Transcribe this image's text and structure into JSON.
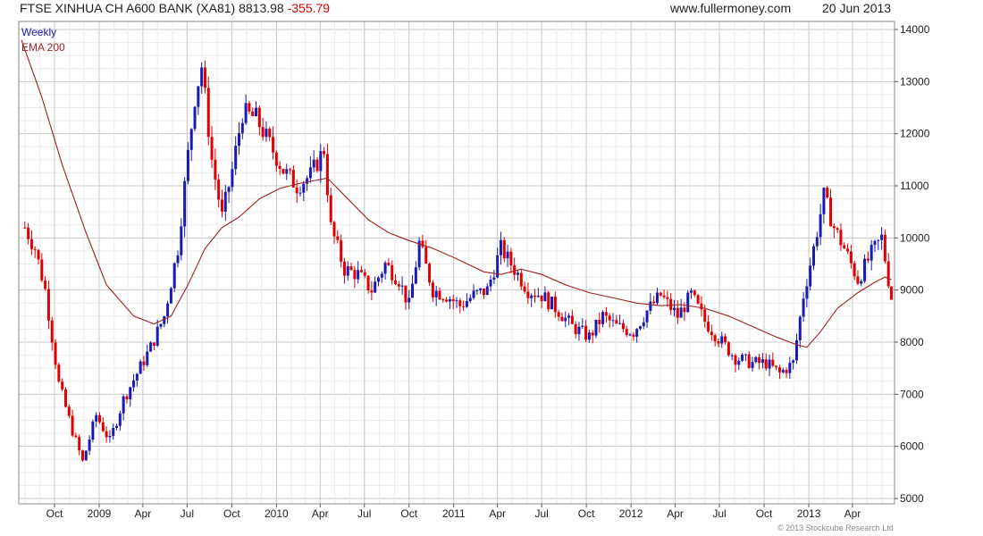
{
  "header": {
    "title": "FTSE XINHUA CH A600 BANK (XA81) 8813.98",
    "change": "-355.79",
    "site": "www.fullermoney.com",
    "date": "20 Jun 2013"
  },
  "copyright": "© 2013 Stockcube Research Ltd",
  "colors": {
    "up": "#1a1ab5",
    "down": "#e00000",
    "ema": "#a02020",
    "grid": "#d9d9d9"
  },
  "chart_data": {
    "type": "candlestick",
    "title": "FTSE XINHUA CH A600 BANK (XA81)",
    "frequency_label": "Weekly",
    "legend": [
      "Weekly",
      "EMA 200"
    ],
    "legend_position": "top-left",
    "grid": true,
    "y_axis_side": "right",
    "ylim": [
      5000,
      14000
    ],
    "yticks": [
      5000,
      6000,
      7000,
      8000,
      9000,
      10000,
      11000,
      12000,
      13000,
      14000
    ],
    "x_labels": [
      "Oct",
      "2009",
      "Apr",
      "Jul",
      "Oct",
      "2010",
      "Apr",
      "Jul",
      "Oct",
      "2011",
      "Apr",
      "Jul",
      "Oct",
      "2012",
      "Apr",
      "Jul",
      "Oct",
      "2013",
      "Apr"
    ],
    "last_close": 8813.98,
    "change": -355.79,
    "series": [
      {
        "name": "Weekly",
        "close_path": [
          [
            "2008-08-01",
            10200
          ],
          [
            "2008-08-22",
            9800
          ],
          [
            "2008-09-12",
            9000
          ],
          [
            "2008-10-10",
            7200
          ],
          [
            "2008-11-07",
            6300
          ],
          [
            "2008-11-28",
            5700
          ],
          [
            "2008-12-26",
            6600
          ],
          [
            "2009-01-23",
            6100
          ],
          [
            "2009-02-20",
            6900
          ],
          [
            "2009-03-20",
            7400
          ],
          [
            "2009-04-17",
            7900
          ],
          [
            "2009-05-15",
            8500
          ],
          [
            "2009-06-12",
            9800
          ],
          [
            "2009-07-03",
            11600
          ],
          [
            "2009-07-17",
            12700
          ],
          [
            "2009-07-31",
            13300
          ],
          [
            "2009-08-21",
            11500
          ],
          [
            "2009-09-11",
            10400
          ],
          [
            "2009-10-02",
            11300
          ],
          [
            "2009-10-23",
            12400
          ],
          [
            "2009-11-20",
            12300
          ],
          [
            "2009-12-18",
            11800
          ],
          [
            "2010-01-15",
            11300
          ],
          [
            "2010-02-12",
            11000
          ],
          [
            "2010-03-12",
            11200
          ],
          [
            "2010-04-09",
            11700
          ],
          [
            "2010-04-23",
            10200
          ],
          [
            "2010-05-21",
            9400
          ],
          [
            "2010-06-18",
            9300
          ],
          [
            "2010-07-16",
            9000
          ],
          [
            "2010-08-13",
            9500
          ],
          [
            "2010-09-10",
            9200
          ],
          [
            "2010-10-01",
            8700
          ],
          [
            "2010-10-22",
            9900
          ],
          [
            "2010-11-19",
            9000
          ],
          [
            "2010-12-17",
            8900
          ],
          [
            "2011-01-14",
            8700
          ],
          [
            "2011-02-11",
            8900
          ],
          [
            "2011-03-11",
            9000
          ],
          [
            "2011-04-08",
            9800
          ],
          [
            "2011-05-06",
            9400
          ],
          [
            "2011-06-03",
            9000
          ],
          [
            "2011-07-01",
            8900
          ],
          [
            "2011-08-05",
            8600
          ],
          [
            "2011-09-02",
            8300
          ],
          [
            "2011-10-07",
            8100
          ],
          [
            "2011-11-04",
            8500
          ],
          [
            "2011-12-02",
            8300
          ],
          [
            "2012-01-06",
            8200
          ],
          [
            "2012-02-03",
            8600
          ],
          [
            "2012-03-02",
            8900
          ],
          [
            "2012-04-06",
            8500
          ],
          [
            "2012-05-04",
            8900
          ],
          [
            "2012-06-01",
            8400
          ],
          [
            "2012-07-06",
            8000
          ],
          [
            "2012-08-03",
            7700
          ],
          [
            "2012-09-07",
            7600
          ],
          [
            "2012-10-05",
            7600
          ],
          [
            "2012-11-02",
            7400
          ],
          [
            "2012-11-30",
            7600
          ],
          [
            "2012-12-21",
            8900
          ],
          [
            "2013-01-11",
            9800
          ],
          [
            "2013-02-01",
            10800
          ],
          [
            "2013-02-22",
            10200
          ],
          [
            "2013-03-15",
            9800
          ],
          [
            "2013-04-12",
            9200
          ],
          [
            "2013-05-10",
            9700
          ],
          [
            "2013-05-31",
            10000
          ],
          [
            "2013-06-14",
            9200
          ],
          [
            "2013-06-20",
            8814
          ]
        ]
      },
      {
        "name": "EMA 200",
        "values": [
          [
            "2008-07-25",
            13800
          ],
          [
            "2008-09-05",
            12700
          ],
          [
            "2008-10-17",
            11400
          ],
          [
            "2008-12-05",
            10100
          ],
          [
            "2009-01-16",
            9100
          ],
          [
            "2009-03-13",
            8500
          ],
          [
            "2009-04-24",
            8350
          ],
          [
            "2009-05-29",
            8500
          ],
          [
            "2009-07-03",
            9100
          ],
          [
            "2009-08-07",
            9800
          ],
          [
            "2009-09-11",
            10200
          ],
          [
            "2009-10-16",
            10400
          ],
          [
            "2009-11-27",
            10750
          ],
          [
            "2010-01-08",
            10950
          ],
          [
            "2010-02-19",
            11050
          ],
          [
            "2010-04-16",
            11150
          ],
          [
            "2010-05-28",
            10750
          ],
          [
            "2010-07-09",
            10350
          ],
          [
            "2010-08-20",
            10100
          ],
          [
            "2010-10-01",
            9950
          ],
          [
            "2010-11-19",
            9800
          ],
          [
            "2011-01-07",
            9600
          ],
          [
            "2011-03-04",
            9350
          ],
          [
            "2011-04-08",
            9300
          ],
          [
            "2011-05-20",
            9400
          ],
          [
            "2011-07-01",
            9300
          ],
          [
            "2011-08-19",
            9100
          ],
          [
            "2011-10-07",
            8950
          ],
          [
            "2011-11-25",
            8850
          ],
          [
            "2012-01-13",
            8750
          ],
          [
            "2012-03-02",
            8700
          ],
          [
            "2012-04-13",
            8720
          ],
          [
            "2012-06-01",
            8650
          ],
          [
            "2012-07-20",
            8500
          ],
          [
            "2012-09-07",
            8300
          ],
          [
            "2012-10-26",
            8100
          ],
          [
            "2012-12-07",
            7950
          ],
          [
            "2012-12-28",
            7900
          ],
          [
            "2013-01-25",
            8200
          ],
          [
            "2013-03-01",
            8650
          ],
          [
            "2013-04-12",
            8950
          ],
          [
            "2013-05-17",
            9150
          ],
          [
            "2013-06-07",
            9250
          ],
          [
            "2013-06-20",
            9200
          ]
        ]
      }
    ]
  }
}
